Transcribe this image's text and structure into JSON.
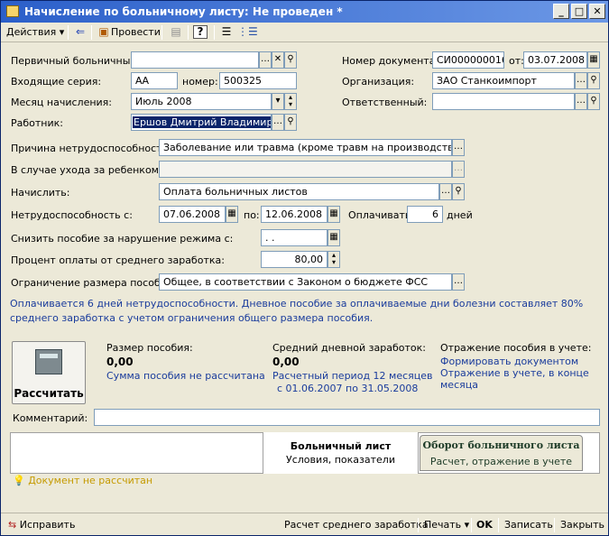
{
  "window": {
    "title": "Начисление по больничному листу: Не проведен *"
  },
  "toolbar": {
    "actions_label": "Действия",
    "post_label": "Провести"
  },
  "fields": {
    "primary_sick_label": "Первичный больничный:",
    "doc_number_label": "Номер документа:",
    "doc_number_value": "СИ000000016",
    "date_from_label": "от:",
    "doc_date_value": "03.07.2008",
    "incoming_series_label": "Входящие серия:",
    "series_value": "АА",
    "number_label": "номер:",
    "number_value": "500325",
    "organization_label": "Организация:",
    "organization_value": "ЗАО Станкоимпорт",
    "month_label": "Месяц начисления:",
    "month_value": "Июль 2008",
    "responsible_label": "Ответственный:",
    "employee_label": "Работник:",
    "employee_value": "Ершов Дмитрий Владимирович",
    "cause_label": "Причина нетрудоспособности:",
    "cause_value": "Заболевание или травма (кроме травм на производстве)",
    "childcare_label": "В случае ухода за ребенком:",
    "accrue_label": "Начислить:",
    "accrue_value": "Оплата больничных листов",
    "disability_from_label": "Нетрудоспособность с:",
    "disability_from_value": "07.06.2008",
    "to_label": "по:",
    "disability_to_value": "12.06.2008",
    "pay_label": "Оплачивать:",
    "pay_days_value": "6",
    "days_label": "дней",
    "reduce_label": "Снизить пособие за нарушение режима с:",
    "reduce_value": " .  .",
    "percent_label": "Процент оплаты от среднего заработка:",
    "percent_value": "80,00",
    "limit_label": "Ограничение размера пособия:",
    "limit_value": "Общее, в соответствии с Законом о бюджете ФСС"
  },
  "note": "Оплачивается 6 дней нетрудоспособности. Дневное пособие за оплачиваемые дни болезни составляет 80% среднего заработка с учетом ограничения общего размера пособия.",
  "calc": {
    "button_label": "Рассчитать",
    "benefit_label": "Размер пособия:",
    "benefit_value": "0,00",
    "benefit_status": "Сумма пособия не рассчитана",
    "avg_label": "Средний дневной заработок:",
    "avg_value": "0,00",
    "avg_period_1": "Расчетный период 12 месяцев",
    "avg_period_2": "с 01.06.2007 по 31.05.2008",
    "reflection_label": "Отражение пособия в учете:",
    "reflection_link_1": "Формировать документом",
    "reflection_link_2": "Отражение в учете, в конце месяца"
  },
  "comment_label": "Комментарий:",
  "tabs": [
    {
      "title": "Больничный лист",
      "subtitle": "Условия, показатели"
    },
    {
      "title": "Оборот больничного листа",
      "subtitle": "Расчет, отражение в учете"
    }
  ],
  "status": "Документ не рассчитан",
  "footer": {
    "fix": "Исправить",
    "avg_calc": "Расчет среднего заработка",
    "print": "Печать",
    "ok": "OK",
    "save": "Записать",
    "close": "Закрыть"
  },
  "colors": {
    "title_bar": "#2b5fc9",
    "link": "#1a3c9c",
    "status": "#c59a00"
  }
}
